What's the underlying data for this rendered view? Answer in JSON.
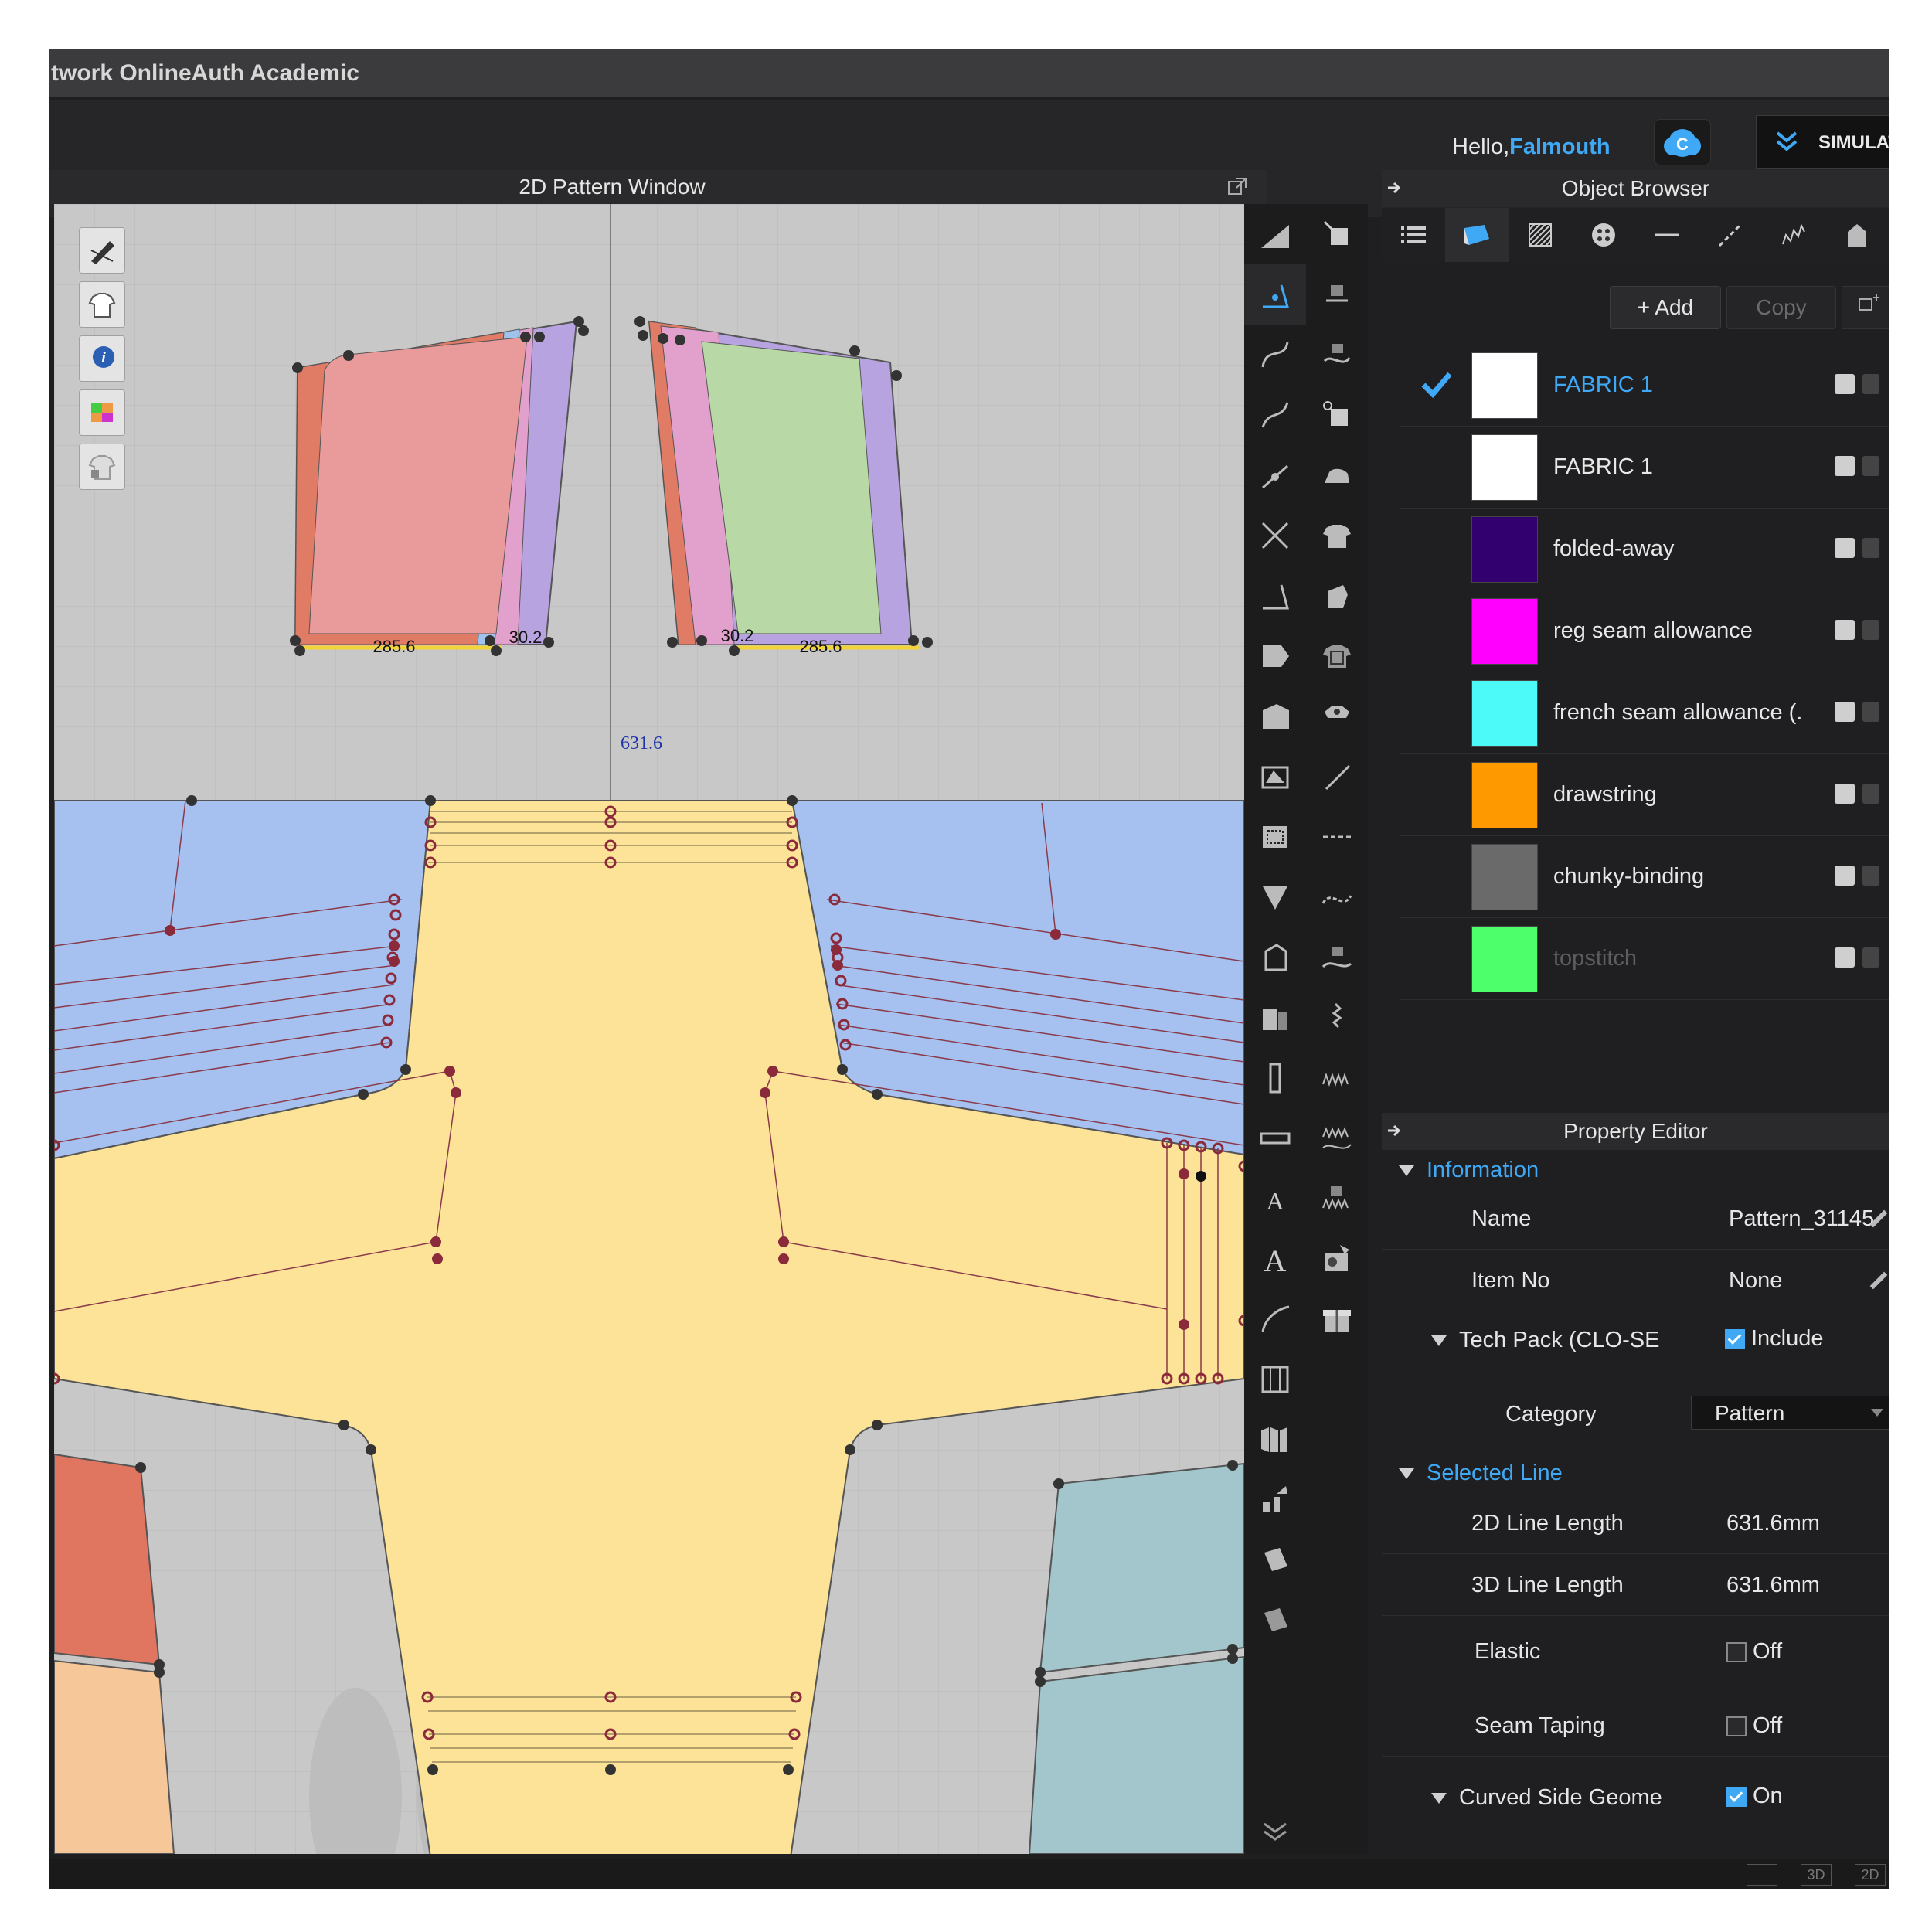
{
  "window_title": "twork OnlineAuth Academic",
  "topbar": {
    "greeting": "Hello,",
    "username": "Falmouth",
    "simulation_label": "SIMULAT"
  },
  "pattern_window": {
    "title": "2D Pattern Window",
    "measurements": {
      "center_line": "631.6",
      "left_bottom": "285.6",
      "left_small": "30.2",
      "right_small": "30.2",
      "right_bottom": "285.6"
    },
    "left_tools": [
      "pen-tool-icon",
      "tshirt-icon",
      "info-icon",
      "color-palette-icon",
      "lock-tshirt-icon"
    ]
  },
  "object_browser": {
    "title": "Object Browser",
    "tabs": [
      "list-icon",
      "fabric-icon",
      "texture-icon",
      "button-icon",
      "line-icon",
      "topstitch-icon",
      "zigzag-icon",
      "avatar-icon"
    ],
    "active_tab": 1,
    "add_label": "+ Add",
    "copy_label": "Copy",
    "fabrics": [
      {
        "name": "FABRIC 1",
        "color": "#ffffff",
        "selected": true
      },
      {
        "name": "FABRIC 1",
        "color": "#ffffff",
        "selected": false
      },
      {
        "name": "folded-away",
        "color": "#33006f",
        "selected": false
      },
      {
        "name": "reg seam allowance",
        "color": "#ff00ff",
        "selected": false
      },
      {
        "name": "french seam allowance (.",
        "color": "#4dfafa",
        "selected": false
      },
      {
        "name": "drawstring",
        "color": "#ff9900",
        "selected": false
      },
      {
        "name": "chunky-binding",
        "color": "#6a6a6a",
        "selected": false
      },
      {
        "name": "topstitch",
        "color": "#4dff6a",
        "selected": false,
        "dimmed": true
      }
    ]
  },
  "property_editor": {
    "title": "Property Editor",
    "information": {
      "header": "Information",
      "name_label": "Name",
      "name_value": "Pattern_31145",
      "item_label": "Item No",
      "item_value": "None",
      "techpack_label": "Tech Pack (CLO-SE",
      "techpack_value": "Include",
      "category_label": "Category",
      "category_value": "Pattern"
    },
    "selected_line": {
      "header": "Selected Line",
      "len2d_label": "2D Line Length",
      "len2d_value": "631.6mm",
      "len3d_label": "3D Line Length",
      "len3d_value": "631.6mm",
      "elastic_label": "Elastic",
      "elastic_value": "Off",
      "taping_label": "Seam Taping",
      "taping_value": "Off",
      "curved_label": "Curved Side Geome",
      "curved_value": "On"
    }
  },
  "colors": {
    "accent": "#3fa9f5",
    "panel_bg": "#1f1f21",
    "canvas_bg": "#c8c8c8",
    "body_piece": "#fce397",
    "sleeve_piece": "#a6c1f0",
    "pocket_left": "#e99a9a",
    "pocket_right": "#b8d8a6",
    "seam_red": "#e07b66",
    "seam_purple": "#b7a3e0",
    "lower_red": "#e17660",
    "lower_peach": "#f6c899",
    "lower_teal": "#a3c6cc"
  }
}
